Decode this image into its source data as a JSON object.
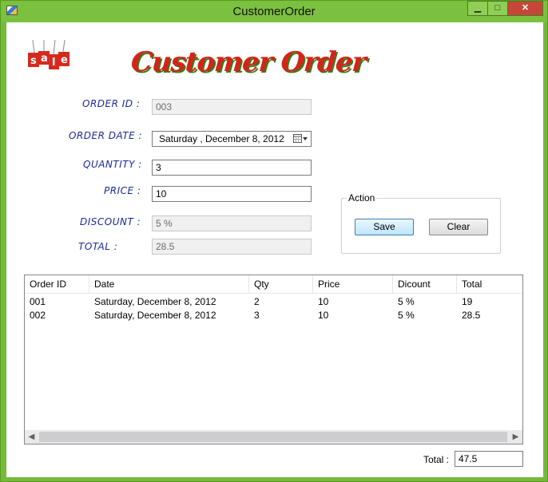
{
  "window": {
    "title": "CustomerOrder",
    "controls": {
      "minimize": "▁",
      "maximize": "□",
      "close": "✕"
    }
  },
  "logo": {
    "text": "sale",
    "icon": "sale-tags-icon"
  },
  "heading": "Customer Order",
  "form": {
    "order_id": {
      "label": "ORDER ID :",
      "value": "003"
    },
    "order_date": {
      "label": "ORDER DATE :",
      "value": "Saturday   , December   8, 2012"
    },
    "quantity": {
      "label": "QUANTITY :",
      "value": "3"
    },
    "price": {
      "label": "PRICE :",
      "value": "10"
    },
    "discount": {
      "label": "DISCOUNT :",
      "placeholder": "5 %"
    },
    "total": {
      "label": "TOTAL :",
      "value": "28.5"
    }
  },
  "action_group": {
    "title": "Action",
    "save_label": "Save",
    "clear_label": "Clear"
  },
  "orders_list": {
    "columns": [
      "Order ID",
      "Date",
      "Qty",
      "Price",
      "Dicount",
      "Total"
    ],
    "rows": [
      [
        "001",
        "Saturday, December 8, 2012",
        "2",
        "10",
        "5 %",
        "19"
      ],
      [
        "002",
        "Saturday, December 8, 2012",
        "3",
        "10",
        "5 %",
        "28.5"
      ]
    ]
  },
  "grand_total": {
    "label": "Total :",
    "value": "47.5"
  },
  "colors": {
    "label_blue": "#1c2a9a",
    "heading_red": "#d42418",
    "window_green": "#76b83a"
  }
}
